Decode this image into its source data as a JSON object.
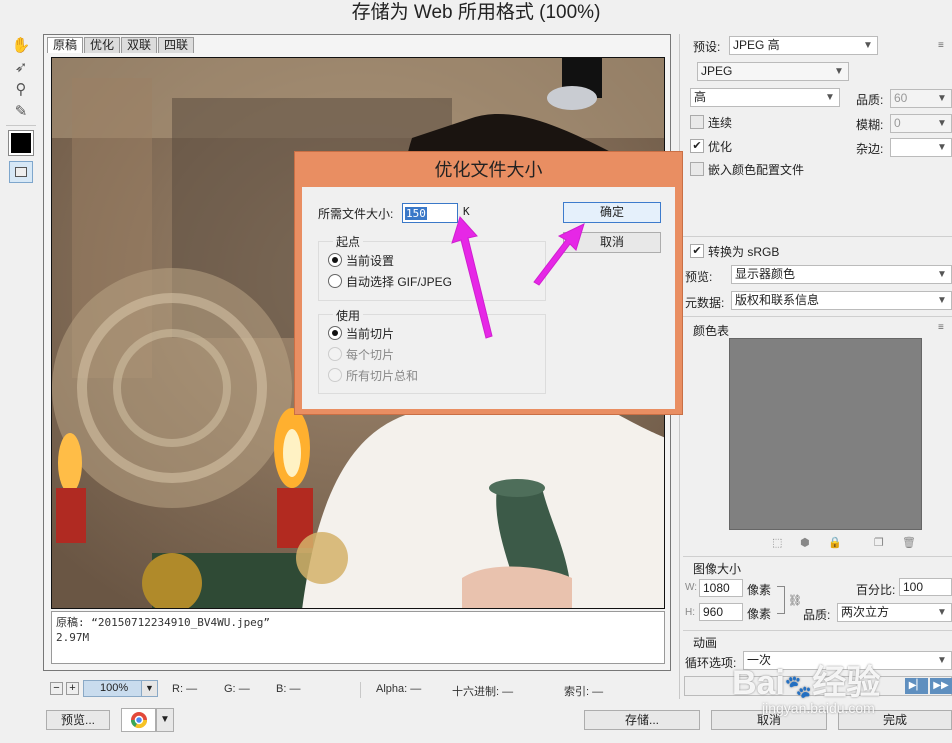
{
  "window": {
    "title": "存储为 Web 所用格式 (100%)"
  },
  "tabs": [
    "原稿",
    "优化",
    "双联",
    "四联"
  ],
  "info": {
    "line1": "原稿: “20150712234910_BV4WU.jpeg”",
    "line2": "2.97M"
  },
  "status": {
    "zoom": "100%",
    "r_label": "R:",
    "r_value": "—",
    "g_label": "G:",
    "g_value": "—",
    "b_label": "B:",
    "b_value": "—",
    "alpha_label": "Alpha:",
    "alpha_value": "—",
    "hex_label": "十六进制:",
    "hex_value": "—",
    "index_label": "索引:",
    "index_value": "—"
  },
  "bottom": {
    "preview": "预览...",
    "save": "存储...",
    "cancel": "取消",
    "done": "完成"
  },
  "right": {
    "preset_label": "预设:",
    "preset_value": "JPEG 高",
    "format_value": "JPEG",
    "quality_select": "高",
    "quality_label": "品质:",
    "quality_value": "60",
    "blur_label": "模糊:",
    "blur_value": "0",
    "matte_label": "杂边:",
    "progressive": "连续",
    "optimized": "优化",
    "embed_profile": "嵌入颜色配置文件",
    "convert_srgb": "转换为 sRGB",
    "preview_label": "预览:",
    "preview_value": "显示器颜色",
    "metadata_label": "元数据:",
    "metadata_value": "版权和联系信息",
    "color_table": "颜色表",
    "image_size": "图像大小",
    "w_label": "W:",
    "w_value": "1080",
    "w_unit": "像素",
    "h_label": "H:",
    "h_value": "960",
    "h_unit": "像素",
    "percent_label": "百分比:",
    "percent_value": "100",
    "resample_label": "品质:",
    "resample_value": "两次立方",
    "animation": "动画",
    "loop_label": "循环选项:",
    "loop_value": "一次"
  },
  "dialog": {
    "title": "优化文件大小",
    "size_label": "所需文件大小:",
    "size_value": "150",
    "size_unit": "K",
    "ok": "确定",
    "cancel": "取消",
    "start_group": "起点",
    "current_settings": "当前设置",
    "auto_select": "自动选择 GIF/JPEG",
    "use_group": "使用",
    "current_slice": "当前切片",
    "each_slice": "每个切片",
    "all_slices": "所有切片总和"
  },
  "watermark": {
    "brand": "Bai",
    "brand2": "经验",
    "url": "jingyan.baidu.com"
  },
  "colors": {
    "dialog_title_bar": "#e98e62",
    "arrow": "#e627e6",
    "color_table_fill": "#808080"
  }
}
